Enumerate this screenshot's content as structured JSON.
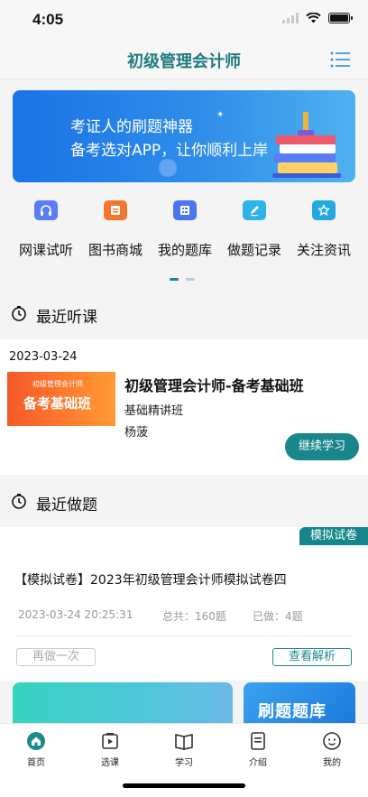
{
  "status_bar": {
    "time": "4:05"
  },
  "header": {
    "title": "初级管理会计师",
    "menu_icon": "list-menu-icon"
  },
  "banner": {
    "line1": "考证人的刷题神器",
    "line2": "备考选对APP，让你顺利上岸",
    "colors": [
      "#1a73e8",
      "#4fb1f0"
    ]
  },
  "quick_nav": [
    {
      "label": "网课试听",
      "icon": "headphones-icon",
      "color": "#5a7df5"
    },
    {
      "label": "图书商城",
      "icon": "book-store-icon",
      "color": "#f2762e"
    },
    {
      "label": "我的题库",
      "icon": "question-bank-icon",
      "color": "#4a74f0"
    },
    {
      "label": "做题记录",
      "icon": "pencil-record-icon",
      "color": "#2cb3e8"
    },
    {
      "label": "关注资讯",
      "icon": "star-news-icon",
      "color": "#24a8e0"
    }
  ],
  "carousel": {
    "pages": 2,
    "active": 0,
    "active_color": "#1b8a8d",
    "inactive_color": "#a9cfe0"
  },
  "recent_lessons": {
    "title": "最近听课",
    "date": "2023-03-24",
    "thumb_small": "初级管理会计师",
    "thumb_big": "备考基础班",
    "course_title": "初级管理会计师-备考基础班",
    "course_sub": "基础精讲班",
    "teacher": "杨菠",
    "continue_label": "继续学习"
  },
  "recent_practice": {
    "title": "最近做题",
    "tag": "模拟试卷",
    "exam_title": "【模拟试卷】2023年初级管理会计师模拟试卷四",
    "datetime": "2023-03-24 20:25:31",
    "total": "总共：160题",
    "done": "已做：4题",
    "redo_label": "再做一次",
    "analysis_label": "查看解析"
  },
  "promo": {
    "right_text": "刷题题库"
  },
  "tabbar": [
    {
      "label": "首页",
      "icon": "home-icon",
      "active": true
    },
    {
      "label": "选课",
      "icon": "video-course-icon",
      "active": false
    },
    {
      "label": "学习",
      "icon": "open-book-icon",
      "active": false
    },
    {
      "label": "介绍",
      "icon": "document-icon",
      "active": false
    },
    {
      "label": "我的",
      "icon": "smiley-face-icon",
      "active": false
    }
  ],
  "colors": {
    "accent": "#1e7b7e",
    "button": "#18868a"
  }
}
